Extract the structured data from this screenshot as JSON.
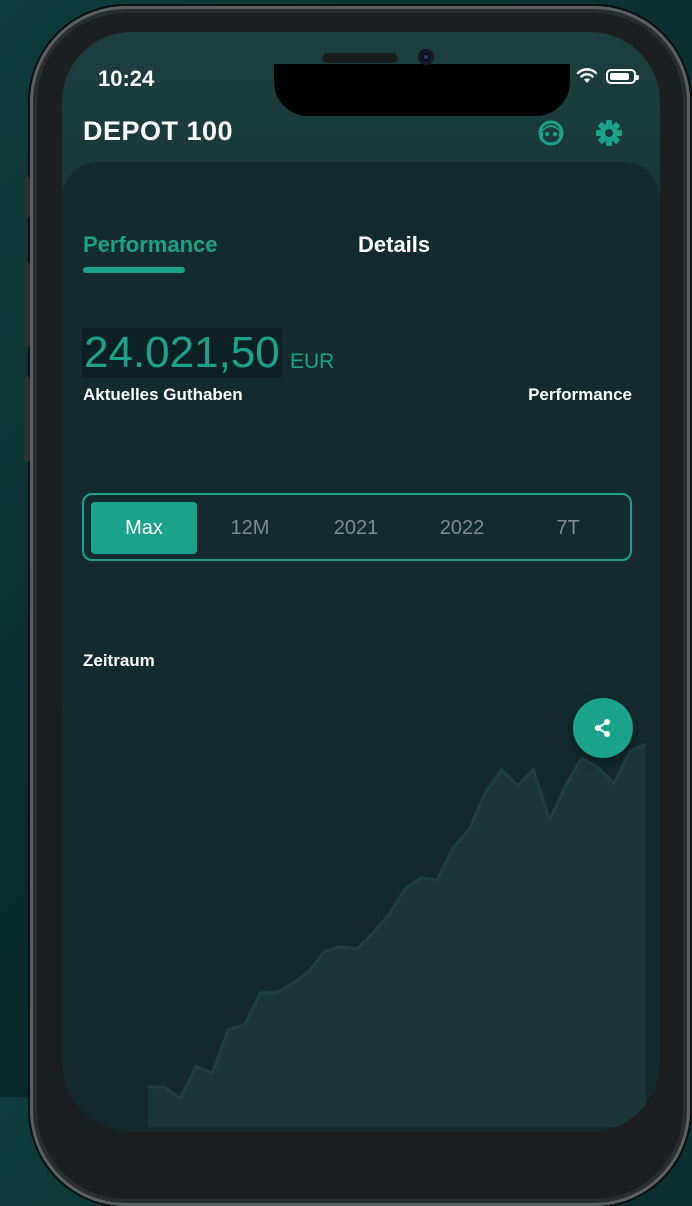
{
  "status_bar": {
    "time": "10:24"
  },
  "app": {
    "title": "DEPOT 100"
  },
  "tabs": [
    {
      "label": "Performance",
      "active": true
    },
    {
      "label": "Details",
      "active": false
    }
  ],
  "balance": {
    "value": "24.021,50",
    "currency": "EUR",
    "label": "Aktuelles Guthaben"
  },
  "performance_label": "Performance",
  "period_selector": {
    "options": [
      "Max",
      "12M",
      "2021",
      "2022",
      "7T"
    ],
    "selected": "Max"
  },
  "period_label": "Zeitraum",
  "icons": {
    "support": "support-agent-icon",
    "settings": "gear-icon",
    "share": "share-icon"
  },
  "colors": {
    "accent": "#1aa38a",
    "background": "#132b2c",
    "header": "#1c3f3f"
  },
  "chart_data": {
    "type": "area",
    "values": [
      0,
      0,
      -5,
      9,
      6,
      25,
      27,
      41,
      41,
      45,
      50,
      59,
      61,
      60,
      67,
      75,
      86,
      91,
      90,
      104,
      112,
      128,
      138,
      131,
      138,
      116,
      131,
      143,
      139,
      132,
      146,
      149
    ],
    "title": "",
    "xlabel": "",
    "ylabel": ""
  }
}
